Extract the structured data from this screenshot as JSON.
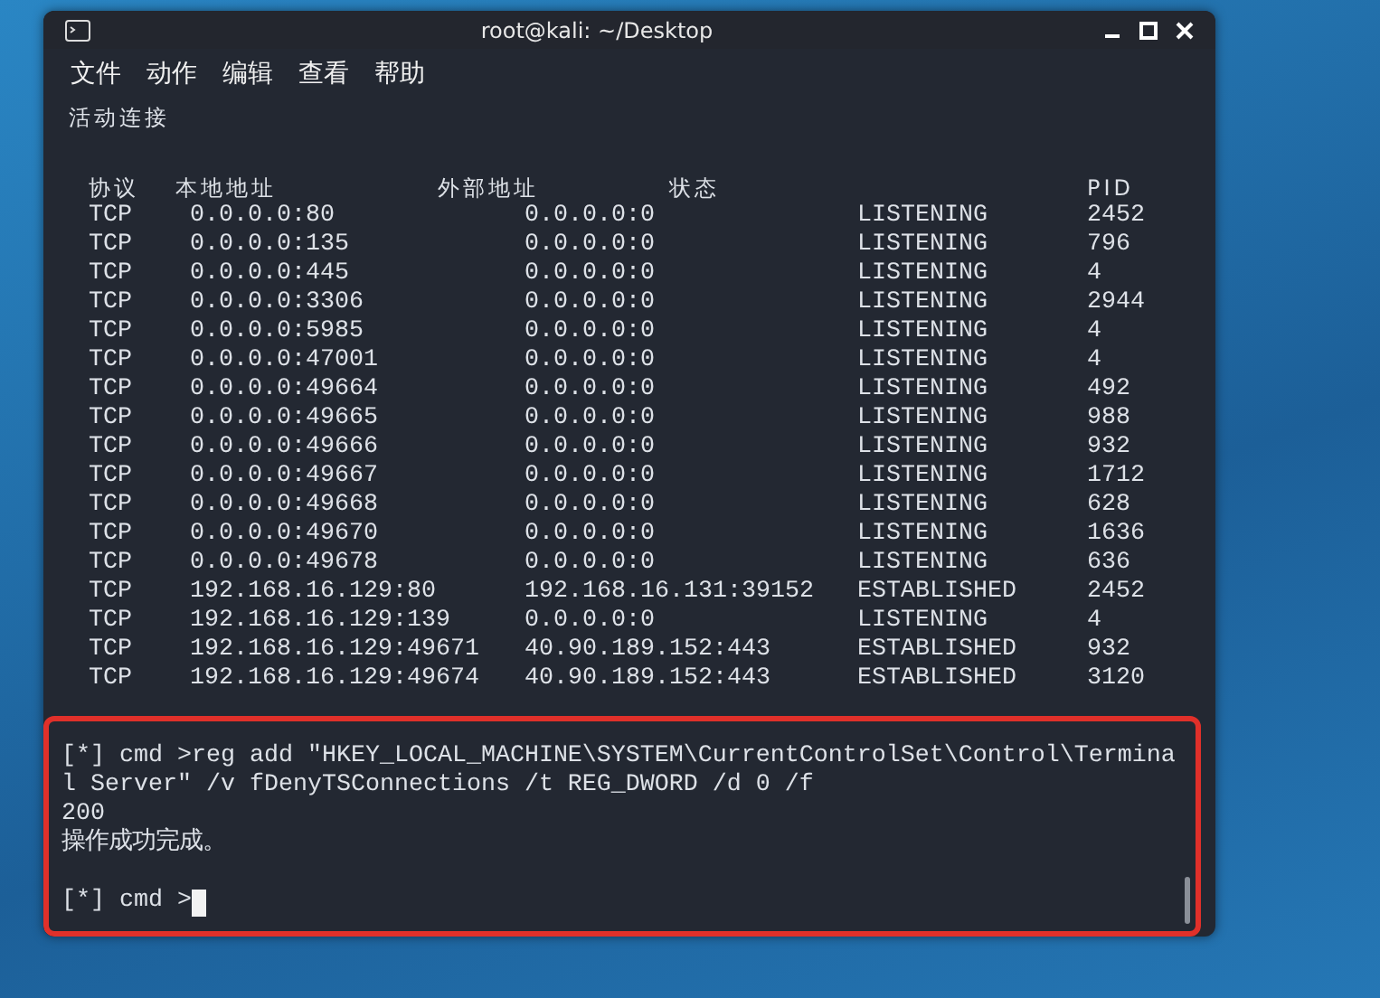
{
  "window": {
    "title": "root@kali: ~/Desktop"
  },
  "menu": [
    "文件",
    "动作",
    "编辑",
    "查看",
    "帮助"
  ],
  "heading": "活动连接",
  "table": {
    "columns": [
      "协议",
      "本地地址",
      "外部地址",
      "状态",
      "PID"
    ],
    "rows": [
      [
        "TCP",
        "0.0.0.0:80",
        "0.0.0.0:0",
        "LISTENING",
        "2452"
      ],
      [
        "TCP",
        "0.0.0.0:135",
        "0.0.0.0:0",
        "LISTENING",
        "796"
      ],
      [
        "TCP",
        "0.0.0.0:445",
        "0.0.0.0:0",
        "LISTENING",
        "4"
      ],
      [
        "TCP",
        "0.0.0.0:3306",
        "0.0.0.0:0",
        "LISTENING",
        "2944"
      ],
      [
        "TCP",
        "0.0.0.0:5985",
        "0.0.0.0:0",
        "LISTENING",
        "4"
      ],
      [
        "TCP",
        "0.0.0.0:47001",
        "0.0.0.0:0",
        "LISTENING",
        "4"
      ],
      [
        "TCP",
        "0.0.0.0:49664",
        "0.0.0.0:0",
        "LISTENING",
        "492"
      ],
      [
        "TCP",
        "0.0.0.0:49665",
        "0.0.0.0:0",
        "LISTENING",
        "988"
      ],
      [
        "TCP",
        "0.0.0.0:49666",
        "0.0.0.0:0",
        "LISTENING",
        "932"
      ],
      [
        "TCP",
        "0.0.0.0:49667",
        "0.0.0.0:0",
        "LISTENING",
        "1712"
      ],
      [
        "TCP",
        "0.0.0.0:49668",
        "0.0.0.0:0",
        "LISTENING",
        "628"
      ],
      [
        "TCP",
        "0.0.0.0:49670",
        "0.0.0.0:0",
        "LISTENING",
        "1636"
      ],
      [
        "TCP",
        "0.0.0.0:49678",
        "0.0.0.0:0",
        "LISTENING",
        "636"
      ],
      [
        "TCP",
        "192.168.16.129:80",
        "192.168.16.131:39152",
        "ESTABLISHED",
        "2452"
      ],
      [
        "TCP",
        "192.168.16.129:139",
        "0.0.0.0:0",
        "LISTENING",
        "4"
      ],
      [
        "TCP",
        "192.168.16.129:49671",
        "40.90.189.152:443",
        "ESTABLISHED",
        "932"
      ],
      [
        "TCP",
        "192.168.16.129:49674",
        "40.90.189.152:443",
        "ESTABLISHED",
        "3120"
      ]
    ]
  },
  "console": {
    "lines": [
      {
        "kind": "output",
        "text": "[*] cmd >reg add \"HKEY_LOCAL_MACHINE\\SYSTEM\\CurrentControlSet\\Control\\Termina"
      },
      {
        "kind": "output",
        "text": "l Server\" /v fDenyTSConnections /t REG_DWORD /d 0 /f"
      },
      {
        "kind": "output",
        "text": "200"
      },
      {
        "kind": "output",
        "text": "操作成功完成。"
      },
      {
        "kind": "prompt",
        "text": "[*] cmd >"
      }
    ]
  }
}
